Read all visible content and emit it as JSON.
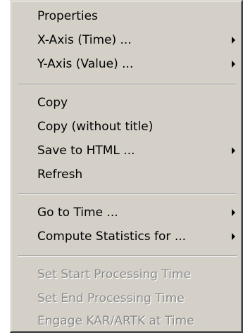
{
  "menu": {
    "items": [
      {
        "label": "Properties",
        "submenu": false,
        "enabled": true
      },
      {
        "label": "X-Axis (Time) ...",
        "submenu": true,
        "enabled": true
      },
      {
        "label": "Y-Axis (Value) ...",
        "submenu": true,
        "enabled": true
      },
      {
        "label": "Copy",
        "submenu": false,
        "enabled": true
      },
      {
        "label": "Copy (without title)",
        "submenu": false,
        "enabled": true
      },
      {
        "label": "Save to HTML ...",
        "submenu": true,
        "enabled": true
      },
      {
        "label": "Refresh",
        "submenu": false,
        "enabled": true
      },
      {
        "label": "Go to Time ...",
        "submenu": true,
        "enabled": true
      },
      {
        "label": "Compute Statistics for ...",
        "submenu": true,
        "enabled": true
      },
      {
        "label": "Set Start Processing Time",
        "submenu": false,
        "enabled": false
      },
      {
        "label": "Set End Processing Time",
        "submenu": false,
        "enabled": false
      },
      {
        "label": "Engage KAR/ARTK at Time",
        "submenu": false,
        "enabled": false
      }
    ]
  },
  "icons": {
    "submenu_arrow": "chevron-right-icon"
  },
  "colors": {
    "menu_background": "#d4d0c8",
    "frame_border": "#8b4f12",
    "disabled_text": "#8a8a8a",
    "text": "#000000"
  }
}
